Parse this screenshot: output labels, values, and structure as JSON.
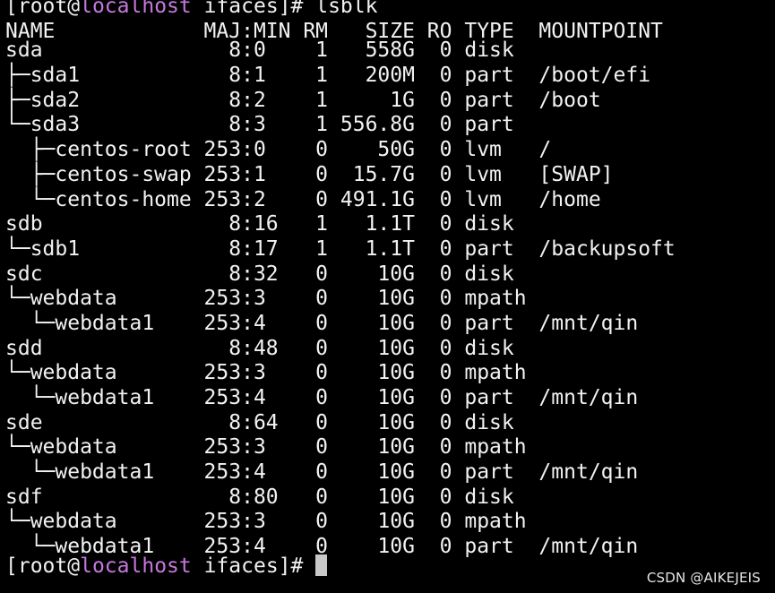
{
  "prompt": {
    "open": "[",
    "user": "root@",
    "host": "localhost",
    "dir": " ifaces]# ",
    "command": "lsblk"
  },
  "header": "NAME            MAJ:MIN RM   SIZE RO TYPE  MOUNTPOINT",
  "rows": [
    "sda               8:0    1   558G  0 disk",
    "├─sda1            8:1    1   200M  0 part  /boot/efi",
    "├─sda2            8:2    1     1G  0 part  /boot",
    "└─sda3            8:3    1 556.8G  0 part",
    "  ├─centos-root 253:0    0    50G  0 lvm   /",
    "  ├─centos-swap 253:1    0  15.7G  0 lvm   [SWAP]",
    "  └─centos-home 253:2    0 491.1G  0 lvm   /home",
    "sdb               8:16   1   1.1T  0 disk",
    "└─sdb1            8:17   1   1.1T  0 part  /backupsoft",
    "sdc               8:32   0    10G  0 disk",
    "└─webdata       253:3    0    10G  0 mpath",
    "  └─webdata1    253:4    0    10G  0 part  /mnt/qin",
    "sdd               8:48   0    10G  0 disk",
    "└─webdata       253:3    0    10G  0 mpath",
    "  └─webdata1    253:4    0    10G  0 part  /mnt/qin",
    "sde               8:64   0    10G  0 disk",
    "└─webdata       253:3    0    10G  0 mpath",
    "  └─webdata1    253:4    0    10G  0 part  /mnt/qin",
    "sdf               8:80   0    10G  0 disk",
    "└─webdata       253:3    0    10G  0 mpath",
    "  └─webdata1    253:4    0    10G  0 part  /mnt/qin"
  ],
  "prompt2": {
    "open": "[",
    "user": "root@",
    "host": "localhost",
    "dir": " ifaces]# "
  },
  "watermark": "CSDN @AIKEJEIS",
  "colors": {
    "background": "#000000",
    "text": "#f2f2f2",
    "hostname": "#c678dd",
    "cursor": "#c8c8c8"
  }
}
